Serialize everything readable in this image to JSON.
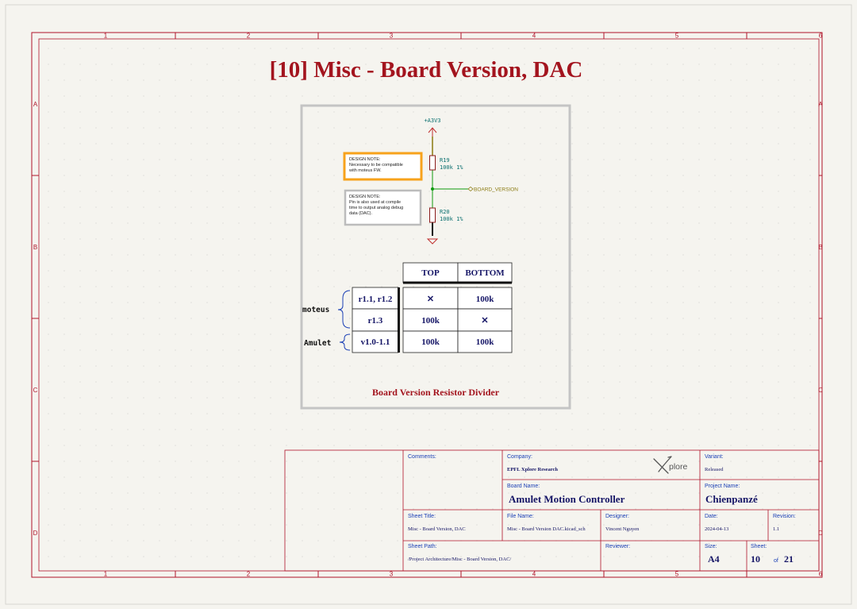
{
  "sheet": {
    "title": "[10] Misc - Board Version, DAC",
    "columns": [
      "1",
      "2",
      "3",
      "4",
      "5",
      "6"
    ],
    "rows": [
      "A",
      "B",
      "C",
      "D"
    ]
  },
  "schematic": {
    "power_label": "+A3V3",
    "r19_ref": "R19",
    "r19_value": "100k 1%",
    "r20_ref": "R20",
    "r20_value": "100k 1%",
    "net_label": "BOARD_VERSION",
    "note1": [
      "DESIGN NOTE:",
      "Necessary to be compatible",
      "with moteus FW."
    ],
    "note2": [
      "DESIGN NOTE:",
      "Pin is also used at compile",
      "time to output analog debug",
      "data (DAC)."
    ]
  },
  "version_table": {
    "headers": [
      "TOP",
      "BOTTOM"
    ],
    "groups": [
      "moteus",
      "Amulet"
    ],
    "rows": [
      {
        "version": "r1.1, r1.2",
        "top": "✕",
        "bottom": "100k"
      },
      {
        "version": "r1.3",
        "top": "100k",
        "bottom": "✕"
      },
      {
        "version": "v1.0-1.1",
        "top": "100k",
        "bottom": "100k"
      }
    ],
    "caption": "Board Version Resistor Divider"
  },
  "title_block": {
    "comments_label": "Comments:",
    "company_label": "Company:",
    "company": "EPFL Xplore Research",
    "logo_text": "plore",
    "variant_label": "Variant:",
    "variant": "Released",
    "board_name_label": "Board Name:",
    "board_name": "Amulet Motion Controller",
    "project_name_label": "Project Name:",
    "project_name": "Chienpanzé",
    "sheet_title_label": "Sheet Title:",
    "sheet_title": "Misc - Board Version, DAC",
    "file_name_label": "File Name:",
    "file_name": "Misc - Board Version DAC.kicad_sch",
    "designer_label": "Designer:",
    "designer": "Vincent Nguyen",
    "date_label": "Date:",
    "date": "2024-04-13",
    "revision_label": "Revision:",
    "revision": "1.1",
    "sheet_path_label": "Sheet Path:",
    "sheet_path": "/Project Architecture/Misc - Board Version, DAC/",
    "reviewer_label": "Reviewer:",
    "size_label": "Size:",
    "size": "A4",
    "sheet_label": "Sheet:",
    "sheet_num": "10",
    "of_label": "of",
    "sheet_total": "21"
  },
  "colors": {
    "frame": "#b0142a",
    "title": "#a3141e",
    "label_blue": "#1a3fb5",
    "value_navy": "#151566",
    "wire_green": "#0e9a0e",
    "resistor": "#8a1a1a",
    "ref_teal": "#0a6f6f",
    "note_orange": "#f7a21b",
    "note_grey": "#bcbcbc",
    "box_grey": "#c4c4c4"
  }
}
